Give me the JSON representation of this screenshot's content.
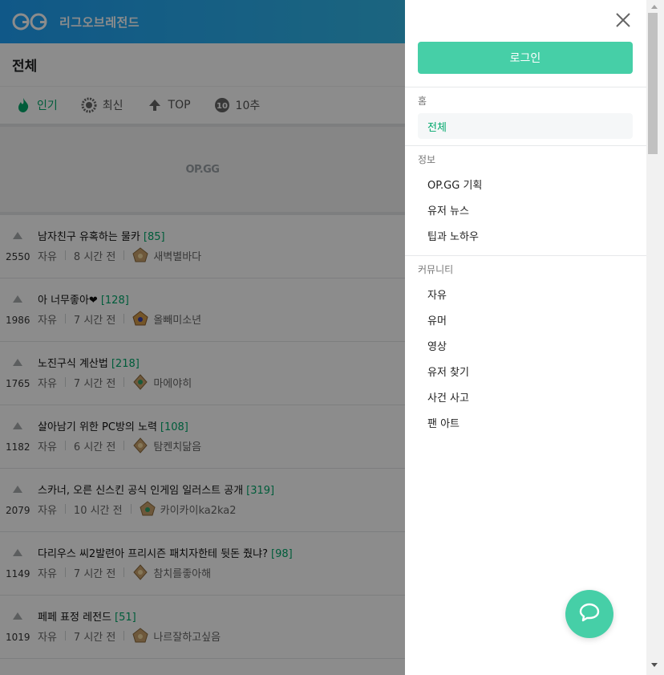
{
  "header": {
    "site_name": "리그오브레전드"
  },
  "board": {
    "title": "전체"
  },
  "sort_tabs": [
    {
      "label": "인기",
      "icon": "flame-icon",
      "active": true
    },
    {
      "label": "최신",
      "icon": "clock-icon",
      "active": false
    },
    {
      "label": "TOP",
      "icon": "arrow-up-icon",
      "active": false
    },
    {
      "label": "10추",
      "icon": "ten-badge-icon",
      "active": false
    }
  ],
  "ad": {
    "label": "OP.GG"
  },
  "posts": [
    {
      "votes": "2550",
      "title": "남자친구 유혹하는 물카",
      "comments": "[85]",
      "category": "자유",
      "time": "8 시간 전",
      "author": "새벽별바다"
    },
    {
      "votes": "1986",
      "title": "아 너무좋아❤",
      "comments": "[128]",
      "category": "자유",
      "time": "7 시간 전",
      "author": "올빼미소년"
    },
    {
      "votes": "1765",
      "title": "노진구식 계산법",
      "comments": "[218]",
      "category": "자유",
      "time": "7 시간 전",
      "author": "마에야히"
    },
    {
      "votes": "1182",
      "title": "살아남기 위한 PC방의 노력",
      "comments": "[108]",
      "category": "자유",
      "time": "6 시간 전",
      "author": "탐켄치닮음"
    },
    {
      "votes": "2079",
      "title": "스카너, 오른 신스킨 공식 인게임 일러스트 공개",
      "comments": "[319]",
      "category": "자유",
      "time": "10 시간 전",
      "author": "카이카이ka2ka2"
    },
    {
      "votes": "1149",
      "title": "다리우스 씨2발련아 프리시즌 패치자한테 뒷돈 줬냐?",
      "comments": "[98]",
      "category": "자유",
      "time": "7 시간 전",
      "author": "참치를좋아해"
    },
    {
      "votes": "1019",
      "title": "페페 표정 레전드",
      "comments": "[51]",
      "category": "자유",
      "time": "7 시간 전",
      "author": "나르잘하고싶음"
    }
  ],
  "drawer": {
    "login_label": "로그인",
    "sections": [
      {
        "label": "홈",
        "items": [
          "전체"
        ]
      },
      {
        "label": "정보",
        "items": [
          "OP.GG 기획",
          "유저 뉴스",
          "팁과 노하우"
        ]
      },
      {
        "label": "커뮤니티",
        "items": [
          "자유",
          "유머",
          "영상",
          "유저 찾기",
          "사건 사고",
          "팬 아트"
        ]
      }
    ]
  },
  "colors": {
    "accent": "#46cfa7",
    "header_start": "#1ea1f7",
    "header_end": "#33b8e8",
    "active_text": "#00a86b"
  }
}
